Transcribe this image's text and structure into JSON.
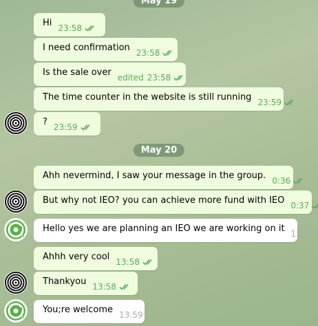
{
  "date_separators": [
    {
      "label": "May 19"
    },
    {
      "label": "May 20"
    }
  ],
  "messages": [
    {
      "text": "Hi",
      "time": "23:58",
      "edited": "",
      "direction": "out"
    },
    {
      "text": "I need confirmation",
      "time": "23:58",
      "edited": "",
      "direction": "out"
    },
    {
      "text": "Is the sale over",
      "time": "23:58",
      "edited": "edited",
      "direction": "out"
    },
    {
      "text": "The time counter in the website is still running",
      "time": "23:59",
      "edited": "",
      "direction": "out"
    },
    {
      "text": "?",
      "time": "23:59",
      "edited": "",
      "direction": "out"
    },
    {
      "text": "Ahh nevermind, I saw your message in the group.",
      "time": "0:36",
      "edited": "",
      "direction": "out"
    },
    {
      "text": "But why not IEO? you can achieve more fund with IEO",
      "time": "0:37",
      "edited": "",
      "direction": "out"
    },
    {
      "text": "Hello yes we are planning an IEO we are working on it",
      "time": "13:57",
      "edited": "",
      "direction": "in"
    },
    {
      "text": "Ahhh very cool",
      "time": "13:58",
      "edited": "",
      "direction": "out"
    },
    {
      "text": "Thankyou",
      "time": "13:58",
      "edited": "",
      "direction": "out"
    },
    {
      "text": "You;re welcome",
      "time": "13:59",
      "edited": "",
      "direction": "in"
    }
  ],
  "colors": {
    "outgoing_bubble": "#effdde",
    "incoming_bubble": "#ffffff",
    "outgoing_time": "#5ba95a",
    "incoming_time": "#a0acb6",
    "date_pill": "#5a785a"
  },
  "icons": {
    "read_receipt": "double-check-icon",
    "own_avatar": "concentric-circles-avatar",
    "peer_avatar": "green-logo-avatar"
  }
}
